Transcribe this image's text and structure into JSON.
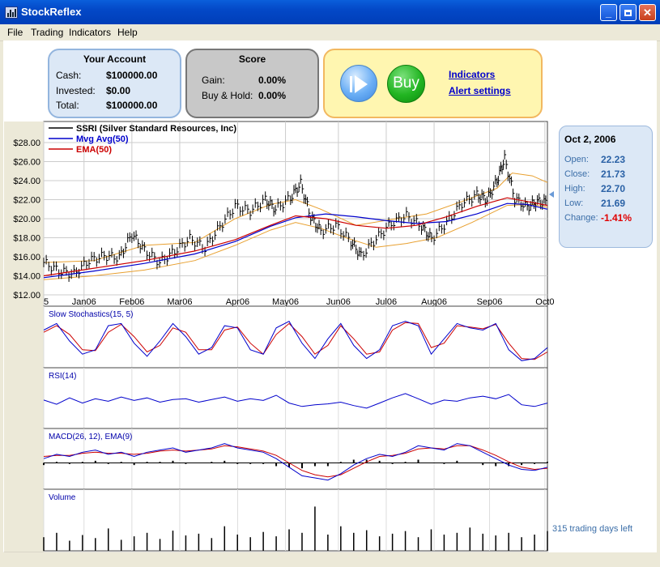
{
  "window": {
    "title": "StockReflex"
  },
  "menu": [
    {
      "label": "File"
    },
    {
      "label": "Trading"
    },
    {
      "label": "Indicators"
    },
    {
      "label": "Help"
    }
  ],
  "account": {
    "title": "Your Account",
    "cash_label": "Cash:",
    "cash_value": "$100000.00",
    "invested_label": "Invested:",
    "invested_value": "$0.00",
    "total_label": "Total:",
    "total_value": "$100000.00"
  },
  "score": {
    "title": "Score",
    "gain_label": "Gain:",
    "gain_value": "0.00%",
    "buyhold_label": "Buy & Hold:",
    "buyhold_value": "0.00%"
  },
  "actions": {
    "buy_label": "Buy",
    "indicators_link": "Indicators",
    "alerts_link": "Alert settings"
  },
  "quote": {
    "date": "Oct 2, 2006",
    "open_label": "Open:",
    "open_value": "22.23",
    "close_label": "Close:",
    "close_value": "21.73",
    "high_label": "High:",
    "high_value": "22.70",
    "low_label": "Low:",
    "low_value": "21.69",
    "change_label": "Change:",
    "change_value": "-1.41%"
  },
  "days_left": "315 trading days left",
  "colors": {
    "price": "#000000",
    "mavg": "#0000CC",
    "ema": "#CC0000",
    "bands": "#E8A030",
    "account_bg": "#DCE8F6",
    "account_border": "#93B5DE",
    "score_bg": "#C8C8C8",
    "score_border": "#777777",
    "actions_bg": "#FFF6B0",
    "actions_border": "#F2B860",
    "negative": "#E00000"
  },
  "chart_data": {
    "type": "line",
    "legend": [
      {
        "name": "SSRI (Silver Standard Resources, Inc)",
        "color": "#000000"
      },
      {
        "name": "Mvg Avg(50)",
        "color": "#0000CC"
      },
      {
        "name": "EMA(50)",
        "color": "#CC0000"
      }
    ],
    "y_ticks": [
      "$28.00",
      "$26.00",
      "$24.00",
      "$22.00",
      "$20.00",
      "$18.00",
      "$16.00",
      "$14.00",
      "$12.00"
    ],
    "ylim": [
      12,
      28
    ],
    "x_ticks": [
      "5",
      "Jan06",
      "Feb06",
      "Mar06",
      "Apr06",
      "May06",
      "Jun06",
      "Jul06",
      "Aug06",
      "Sep06",
      "Oct0"
    ],
    "x_tick_positions": [
      0,
      0.08,
      0.175,
      0.27,
      0.385,
      0.48,
      0.585,
      0.68,
      0.775,
      0.885,
      0.995
    ],
    "price": [
      {
        "x": 0,
        "y": 15.4
      },
      {
        "x": 0.03,
        "y": 14.5
      },
      {
        "x": 0.06,
        "y": 14.2
      },
      {
        "x": 0.09,
        "y": 15.6
      },
      {
        "x": 0.12,
        "y": 16.1
      },
      {
        "x": 0.15,
        "y": 15.9
      },
      {
        "x": 0.175,
        "y": 18.4
      },
      {
        "x": 0.2,
        "y": 16.7
      },
      {
        "x": 0.23,
        "y": 15.4
      },
      {
        "x": 0.26,
        "y": 16.6
      },
      {
        "x": 0.29,
        "y": 17.9
      },
      {
        "x": 0.32,
        "y": 16.9
      },
      {
        "x": 0.35,
        "y": 19.2
      },
      {
        "x": 0.38,
        "y": 21.3
      },
      {
        "x": 0.41,
        "y": 20.8
      },
      {
        "x": 0.44,
        "y": 22.0
      },
      {
        "x": 0.46,
        "y": 21.0
      },
      {
        "x": 0.49,
        "y": 22.2
      },
      {
        "x": 0.51,
        "y": 23.7
      },
      {
        "x": 0.53,
        "y": 20.2
      },
      {
        "x": 0.55,
        "y": 18.7
      },
      {
        "x": 0.58,
        "y": 19.3
      },
      {
        "x": 0.61,
        "y": 17.6
      },
      {
        "x": 0.63,
        "y": 16.1
      },
      {
        "x": 0.66,
        "y": 17.9
      },
      {
        "x": 0.69,
        "y": 19.5
      },
      {
        "x": 0.72,
        "y": 20.3
      },
      {
        "x": 0.75,
        "y": 19.2
      },
      {
        "x": 0.77,
        "y": 17.9
      },
      {
        "x": 0.8,
        "y": 19.6
      },
      {
        "x": 0.83,
        "y": 21.6
      },
      {
        "x": 0.86,
        "y": 22.5
      },
      {
        "x": 0.88,
        "y": 22.0
      },
      {
        "x": 0.9,
        "y": 24.0
      },
      {
        "x": 0.915,
        "y": 26.3
      },
      {
        "x": 0.935,
        "y": 22.1
      },
      {
        "x": 0.96,
        "y": 21.2
      },
      {
        "x": 0.98,
        "y": 21.8
      },
      {
        "x": 1.0,
        "y": 21.7
      }
    ],
    "mavg": [
      {
        "x": 0,
        "y": 13.8
      },
      {
        "x": 0.1,
        "y": 14.5
      },
      {
        "x": 0.2,
        "y": 15.3
      },
      {
        "x": 0.3,
        "y": 16.3
      },
      {
        "x": 0.38,
        "y": 17.6
      },
      {
        "x": 0.45,
        "y": 19.2
      },
      {
        "x": 0.5,
        "y": 20.1
      },
      {
        "x": 0.56,
        "y": 20.5
      },
      {
        "x": 0.62,
        "y": 20.2
      },
      {
        "x": 0.68,
        "y": 19.8
      },
      {
        "x": 0.74,
        "y": 19.5
      },
      {
        "x": 0.8,
        "y": 19.7
      },
      {
        "x": 0.86,
        "y": 20.5
      },
      {
        "x": 0.92,
        "y": 21.6
      },
      {
        "x": 0.96,
        "y": 21.5
      },
      {
        "x": 1.0,
        "y": 21.0
      }
    ],
    "ema": [
      {
        "x": 0,
        "y": 14.0
      },
      {
        "x": 0.1,
        "y": 14.8
      },
      {
        "x": 0.2,
        "y": 15.6
      },
      {
        "x": 0.3,
        "y": 16.6
      },
      {
        "x": 0.38,
        "y": 17.8
      },
      {
        "x": 0.45,
        "y": 19.3
      },
      {
        "x": 0.5,
        "y": 20.3
      },
      {
        "x": 0.56,
        "y": 20.0
      },
      {
        "x": 0.62,
        "y": 19.3
      },
      {
        "x": 0.68,
        "y": 19.0
      },
      {
        "x": 0.74,
        "y": 19.3
      },
      {
        "x": 0.8,
        "y": 20.2
      },
      {
        "x": 0.86,
        "y": 21.3
      },
      {
        "x": 0.92,
        "y": 22.2
      },
      {
        "x": 0.96,
        "y": 21.8
      },
      {
        "x": 1.0,
        "y": 21.4
      }
    ],
    "band_upper": [
      {
        "x": 0,
        "y": 15.4
      },
      {
        "x": 0.1,
        "y": 15.6
      },
      {
        "x": 0.2,
        "y": 17.2
      },
      {
        "x": 0.3,
        "y": 17.5
      },
      {
        "x": 0.38,
        "y": 20.0
      },
      {
        "x": 0.45,
        "y": 21.5
      },
      {
        "x": 0.5,
        "y": 22.0
      },
      {
        "x": 0.55,
        "y": 21.0
      },
      {
        "x": 0.62,
        "y": 19.3
      },
      {
        "x": 0.7,
        "y": 20.0
      },
      {
        "x": 0.76,
        "y": 20.5
      },
      {
        "x": 0.83,
        "y": 21.8
      },
      {
        "x": 0.9,
        "y": 23.2
      },
      {
        "x": 0.93,
        "y": 24.8
      },
      {
        "x": 0.97,
        "y": 24.5
      },
      {
        "x": 1.0,
        "y": 23.8
      }
    ],
    "band_lower": [
      {
        "x": 0,
        "y": 13.6
      },
      {
        "x": 0.1,
        "y": 14.0
      },
      {
        "x": 0.2,
        "y": 14.6
      },
      {
        "x": 0.3,
        "y": 15.6
      },
      {
        "x": 0.38,
        "y": 17.2
      },
      {
        "x": 0.45,
        "y": 18.8
      },
      {
        "x": 0.5,
        "y": 19.6
      },
      {
        "x": 0.55,
        "y": 19.0
      },
      {
        "x": 0.6,
        "y": 18.0
      },
      {
        "x": 0.66,
        "y": 17.0
      },
      {
        "x": 0.72,
        "y": 17.4
      },
      {
        "x": 0.78,
        "y": 18.0
      },
      {
        "x": 0.85,
        "y": 19.6
      },
      {
        "x": 0.92,
        "y": 21.4
      },
      {
        "x": 0.97,
        "y": 21.5
      },
      {
        "x": 1.0,
        "y": 21.2
      }
    ],
    "indicators": [
      {
        "label": "Slow Stochastics(15, 5)",
        "ylim": [
          0,
          1
        ],
        "k": [
          0.75,
          0.9,
          0.5,
          0.2,
          0.3,
          0.85,
          0.9,
          0.45,
          0.15,
          0.5,
          0.9,
          0.6,
          0.2,
          0.35,
          0.85,
          0.8,
          0.3,
          0.2,
          0.8,
          0.95,
          0.45,
          0.1,
          0.55,
          0.9,
          0.4,
          0.1,
          0.3,
          0.85,
          0.95,
          0.85,
          0.2,
          0.55,
          0.9,
          0.8,
          0.75,
          0.9,
          0.3,
          0.05,
          0.1,
          0.35
        ],
        "d": [
          0.7,
          0.85,
          0.65,
          0.3,
          0.28,
          0.7,
          0.88,
          0.6,
          0.25,
          0.4,
          0.8,
          0.7,
          0.3,
          0.3,
          0.75,
          0.82,
          0.45,
          0.2,
          0.65,
          0.9,
          0.6,
          0.2,
          0.4,
          0.85,
          0.55,
          0.2,
          0.25,
          0.75,
          0.92,
          0.9,
          0.35,
          0.45,
          0.85,
          0.82,
          0.78,
          0.88,
          0.45,
          0.1,
          0.08,
          0.25
        ]
      },
      {
        "label": "RSI(14)",
        "ylim": [
          0,
          100
        ],
        "values": [
          55,
          45,
          60,
          48,
          58,
          52,
          62,
          54,
          60,
          50,
          56,
          58,
          50,
          56,
          62,
          52,
          58,
          54,
          66,
          48,
          40,
          44,
          46,
          50,
          42,
          36,
          48,
          60,
          70,
          58,
          45,
          55,
          52,
          60,
          64,
          58,
          68,
          44,
          40,
          48
        ]
      },
      {
        "label": "MACD(26, 12), EMA(9)",
        "ylim": [
          -1,
          1
        ],
        "macd": [
          0.2,
          0.4,
          0.3,
          0.5,
          0.6,
          0.4,
          0.5,
          0.3,
          0.5,
          0.6,
          0.7,
          0.5,
          0.6,
          0.7,
          0.9,
          0.7,
          0.6,
          0.5,
          0.2,
          -0.2,
          -0.6,
          -0.7,
          -0.8,
          -0.5,
          -0.1,
          0.2,
          0.4,
          0.3,
          0.5,
          0.8,
          0.7,
          0.6,
          0.9,
          0.8,
          0.5,
          0.2,
          -0.1,
          -0.3,
          -0.35,
          -0.2
        ],
        "signal": [
          0.3,
          0.35,
          0.35,
          0.45,
          0.5,
          0.45,
          0.45,
          0.4,
          0.45,
          0.55,
          0.6,
          0.55,
          0.6,
          0.65,
          0.8,
          0.75,
          0.65,
          0.55,
          0.35,
          0.0,
          -0.35,
          -0.55,
          -0.65,
          -0.55,
          -0.25,
          0.05,
          0.3,
          0.35,
          0.45,
          0.65,
          0.7,
          0.65,
          0.8,
          0.8,
          0.6,
          0.35,
          0.05,
          -0.2,
          -0.3,
          -0.25
        ],
        "hist": [
          -0.1,
          0.05,
          -0.05,
          0.05,
          0.1,
          -0.05,
          0.05,
          -0.1,
          0.05,
          0.05,
          0.1,
          -0.05,
          0.0,
          0.05,
          0.1,
          -0.05,
          -0.05,
          -0.05,
          -0.15,
          -0.2,
          -0.25,
          -0.15,
          -0.15,
          0.05,
          0.15,
          0.15,
          0.1,
          -0.05,
          0.05,
          0.15,
          0.0,
          -0.05,
          0.1,
          0.0,
          -0.1,
          -0.15,
          -0.15,
          -0.1,
          -0.05,
          0.05
        ]
      },
      {
        "label": "Volume",
        "ylim": [
          0,
          100
        ],
        "values": [
          20,
          30,
          12,
          25,
          18,
          40,
          14,
          22,
          30,
          16,
          35,
          24,
          28,
          18,
          45,
          26,
          20,
          32,
          22,
          38,
          30,
          90,
          26,
          45,
          30,
          36,
          22,
          28,
          34,
          20,
          38,
          26,
          30,
          42,
          28,
          24,
          30,
          20,
          26,
          34
        ]
      }
    ]
  }
}
